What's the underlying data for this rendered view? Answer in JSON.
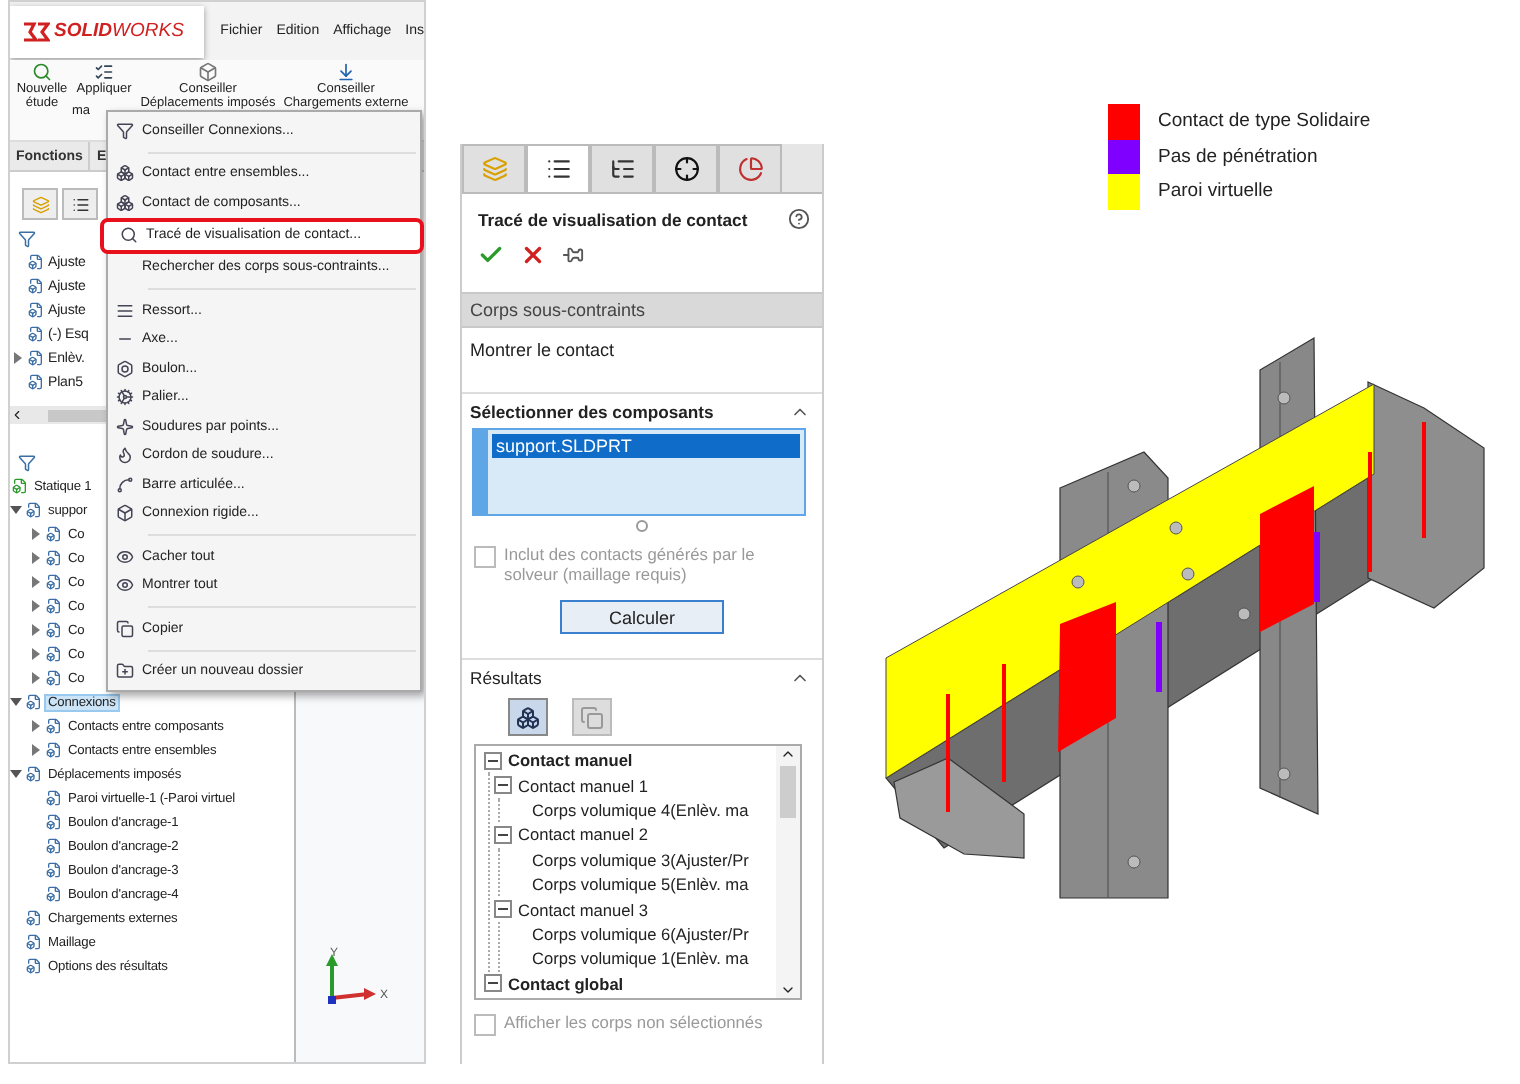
{
  "solidworks_window": {
    "logo": "**SOLID**WORKS",
    "menu": [
      "Fichier",
      "Edition",
      "Affichage",
      "Ins"
    ],
    "toolbar": [
      {
        "label": "Nouvelle étude"
      },
      {
        "label": "Appliquer",
        "sublabel": "ma"
      },
      {
        "label": "Conseiller Déplacements imposés"
      },
      {
        "label": "Conseiller Chargements externe"
      }
    ],
    "tabs": [
      {
        "label": "Fonctions",
        "selected": false
      },
      {
        "label": "E",
        "selected": false
      }
    ],
    "feature_tree": [
      {
        "label": "Ajuste"
      },
      {
        "label": "Ajuste"
      },
      {
        "label": "Ajuste"
      },
      {
        "label": "(-) Esq"
      },
      {
        "label": "Enlèv.",
        "expanded": false
      },
      {
        "label": "Plan5"
      }
    ],
    "study_tree": [
      {
        "label": "Statique 1",
        "selected": false,
        "children": [
          {
            "label": "suppor",
            "expanded": true,
            "selected": false,
            "children": [
              {
                "label": "Co",
                "expanded": false,
                "selected": false
              },
              {
                "label": "Co",
                "expanded": false,
                "selected": false
              },
              {
                "label": "Co",
                "expanded": false,
                "selected": false
              },
              {
                "label": "Co",
                "expanded": false,
                "selected": false
              },
              {
                "label": "Co",
                "expanded": false,
                "selected": false
              },
              {
                "label": "Co",
                "expanded": false,
                "selected": false
              },
              {
                "label": "Co",
                "expanded": false,
                "selected": false
              }
            ]
          },
          {
            "label": "Connexions",
            "expanded": true,
            "selected": true,
            "children": [
              {
                "label": "Contacts entre composants",
                "expanded": false,
                "selected": false
              },
              {
                "label": "Contacts entre ensembles",
                "expanded": false,
                "selected": false
              }
            ]
          },
          {
            "label": "Déplacements imposés",
            "expanded": true,
            "selected": false,
            "children": [
              {
                "label": "Paroi virtuelle-1 (-Paroi virtuel",
                "selected": false
              },
              {
                "label": "Boulon d'ancrage-1",
                "selected": false
              },
              {
                "label": "Boulon d'ancrage-2",
                "selected": false
              },
              {
                "label": "Boulon d'ancrage-3",
                "selected": false
              },
              {
                "label": "Boulon d'ancrage-4",
                "selected": false
              }
            ]
          },
          {
            "label": "Chargements externes",
            "selected": false
          },
          {
            "label": "Maillage",
            "selected": false
          },
          {
            "label": "Options des résultats",
            "selected": false
          }
        ]
      }
    ],
    "triad": {
      "y_label": "Y",
      "x_label": "X"
    },
    "context_menu": [
      [
        {
          "label": "Conseiller Connexions...",
          "selected": false
        }
      ],
      [
        {
          "label": "Contact entre ensembles...",
          "selected": false
        },
        {
          "label": "Contact de composants...",
          "selected": false
        },
        {
          "label": "Tracé de visualisation de contact...",
          "selected": true
        },
        {
          "label": "Rechercher des corps sous-contraints...",
          "selected": false
        }
      ],
      [
        {
          "label": "Ressort...",
          "selected": false
        },
        {
          "label": "Axe...",
          "selected": false
        },
        {
          "label": "Boulon...",
          "selected": false
        },
        {
          "label": "Palier...",
          "selected": false
        },
        {
          "label": "Soudures par points...",
          "selected": false
        },
        {
          "label": "Cordon de soudure...",
          "selected": false
        },
        {
          "label": "Barre articulée...",
          "selected": false
        },
        {
          "label": "Connexion rigide...",
          "selected": false
        }
      ],
      [
        {
          "label": "Cacher tout",
          "selected": false
        },
        {
          "label": "Montrer tout",
          "selected": false
        }
      ],
      [
        {
          "label": "Copier",
          "selected": false
        }
      ],
      [
        {
          "label": "Créer un nouveau dossier",
          "selected": false
        }
      ]
    ]
  },
  "property_manager": {
    "tabs": [
      {
        "selected": false
      },
      {
        "selected": true
      },
      {
        "selected": false
      },
      {
        "selected": false
      },
      {
        "selected": false
      }
    ],
    "title": "Tracé de visualisation de contact",
    "section_bar": "Corps sous-contraints",
    "show_contact": "Montrer le contact",
    "components": {
      "heading": "Sélectionner des composants",
      "expanded": true,
      "items": [
        {
          "label": "support.SLDPRT",
          "selected": true
        }
      ],
      "solver_option": {
        "label": "Inclut des contacts générés par le solveur (maillage requis)",
        "checked": false,
        "disabled": true
      },
      "button": "Calculer"
    },
    "results": {
      "heading": "Résultats",
      "expanded": true,
      "tools": [
        {
          "disabled": false
        },
        {
          "disabled": true
        }
      ],
      "tree": [
        {
          "label": "Contact manuel",
          "expanded": true,
          "children": [
            {
              "label": "Contact manuel 1",
              "expanded": true,
              "children": [
                {
                  "label": "Corps volumique 4(Enlèv. ma"
                }
              ]
            },
            {
              "label": "Contact manuel 2",
              "expanded": true,
              "children": [
                {
                  "label": "Corps volumique 3(Ajuster/Pr"
                },
                {
                  "label": "Corps volumique 5(Enlèv. ma"
                }
              ]
            },
            {
              "label": "Contact manuel 3",
              "expanded": true,
              "children": [
                {
                  "label": "Corps volumique 6(Ajuster/Pr"
                },
                {
                  "label": "Corps volumique 1(Enlèv. ma"
                }
              ]
            }
          ]
        },
        {
          "label": "Contact global",
          "expanded": true
        }
      ],
      "show_unselected": {
        "label": "Afficher les corps non sélectionnés",
        "checked": false,
        "disabled": true
      }
    }
  },
  "legend": [
    {
      "label": "Contact de type Solidaire",
      "color": "#ff0000"
    },
    {
      "label": "Pas de pénétration",
      "color": "#7f00ff"
    },
    {
      "label": "Paroi virtuelle",
      "color": "#ffff00"
    }
  ]
}
